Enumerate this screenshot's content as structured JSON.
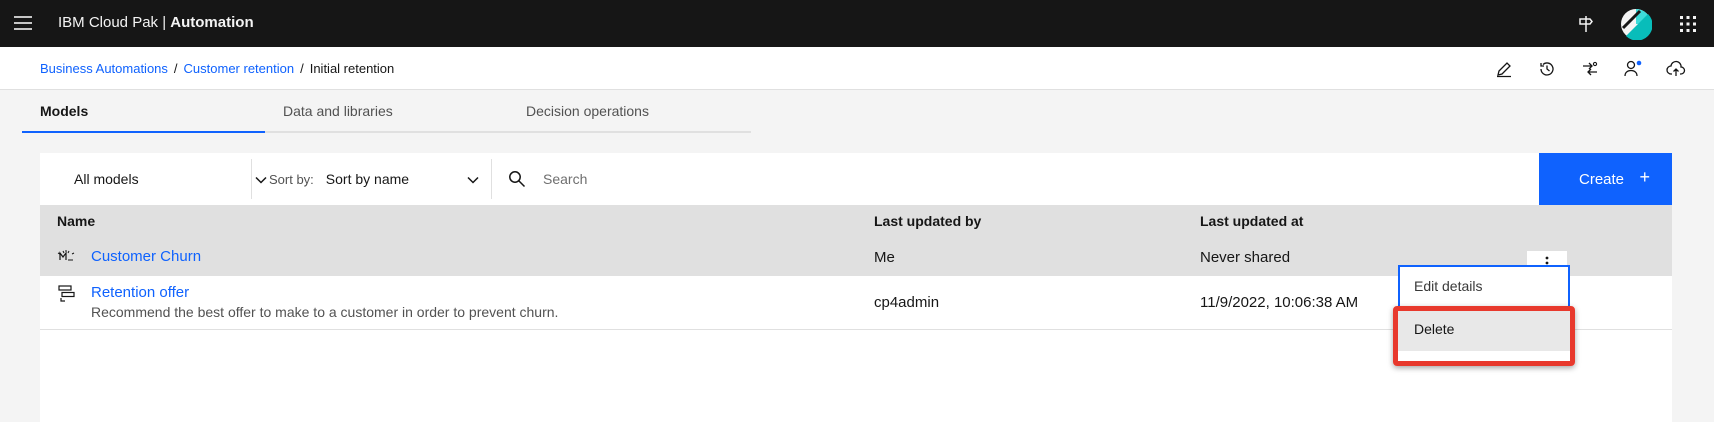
{
  "header": {
    "brand_prefix": "IBM Cloud Pak | ",
    "brand_bold": "Automation",
    "icons": [
      "menu-icon",
      "signpost-icon",
      "avatar",
      "app-switcher-icon"
    ]
  },
  "breadcrumb": {
    "items": [
      "Business Automations",
      "Customer retention"
    ],
    "separator": "/",
    "current": "Initial retention",
    "actions": [
      "edit-icon",
      "history-icon",
      "swap-user-icon",
      "user-icon",
      "cloud-upload-icon"
    ]
  },
  "tabs": [
    {
      "label": "Models",
      "active": true
    },
    {
      "label": "Data and libraries",
      "active": false
    },
    {
      "label": "Decision operations",
      "active": false
    }
  ],
  "toolbar": {
    "filter_value": "All models",
    "sort_label": "Sort by:",
    "sort_value": "Sort by name",
    "search_placeholder": "Search",
    "create_label": "Create",
    "create_icon": "+"
  },
  "table": {
    "columns": [
      "Name",
      "Last updated by",
      "Last updated at"
    ],
    "rows": [
      {
        "icon": "ml-model-icon",
        "name": "Customer Churn",
        "description": "",
        "updated_by": "Me",
        "updated_at": "Never shared"
      },
      {
        "icon": "decision-model-icon",
        "name": "Retention offer",
        "description": "Recommend the best offer to make to a customer in order to prevent churn.",
        "updated_by": "cp4admin",
        "updated_at": "11/9/2022, 10:06:38 AM"
      }
    ]
  },
  "overflow_menu": {
    "items": [
      "Edit details",
      "Delete"
    ]
  },
  "colors": {
    "accent": "#0f62fe",
    "header_bg": "#161616",
    "highlight": "#e8392d"
  }
}
